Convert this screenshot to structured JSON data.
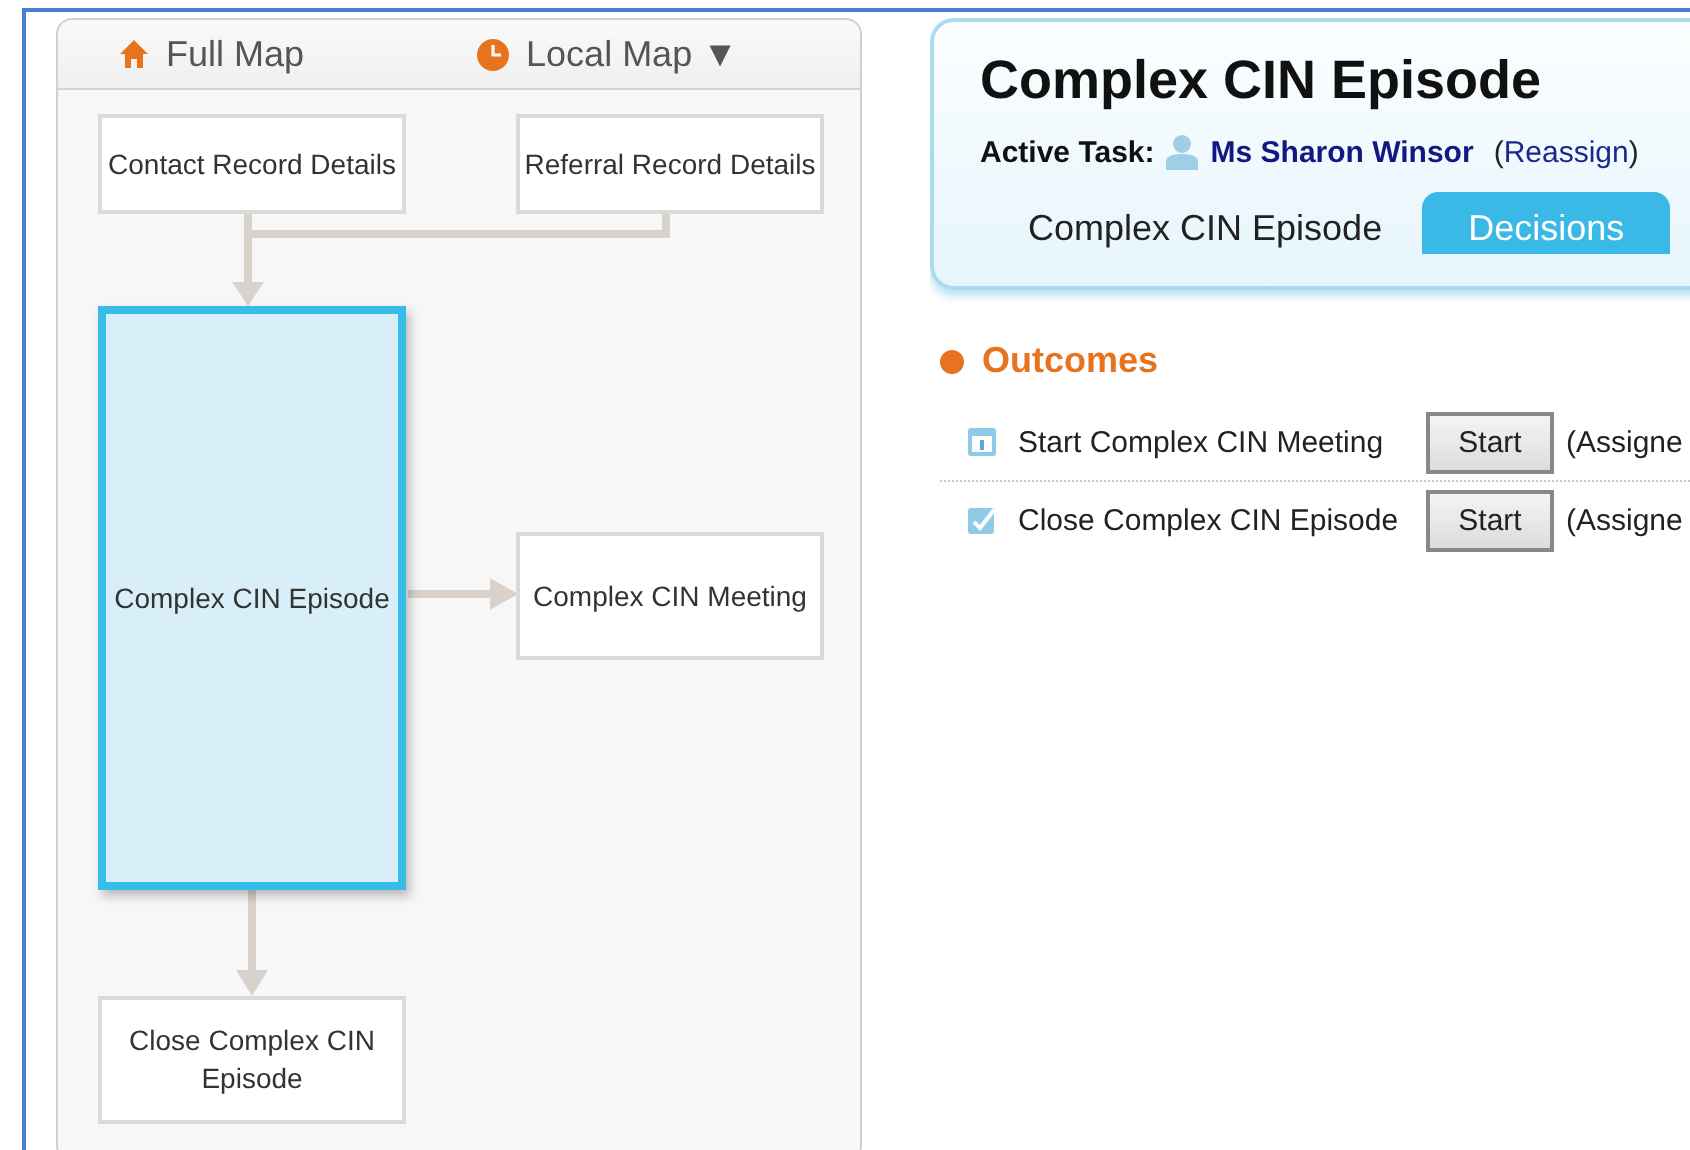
{
  "map_panel": {
    "tabs": [
      {
        "label": "Full Map"
      },
      {
        "label": "Local Map ▼"
      }
    ],
    "nodes": [
      {
        "label": "Contact Record Details",
        "selected": false
      },
      {
        "label": "Referral Record Details",
        "selected": false
      },
      {
        "label": "Complex CIN Episode",
        "selected": true
      },
      {
        "label": "Complex CIN Meeting",
        "selected": false
      },
      {
        "label": "Close Complex CIN Episode",
        "selected": false
      }
    ]
  },
  "header": {
    "title": "Complex CIN Episode",
    "active_task_label": "Active Task:",
    "assignee": "Ms Sharon Winsor",
    "reassign": "Reassign",
    "paren_open": "(",
    "paren_close": ")",
    "tabs": [
      {
        "label": "Complex CIN Episode",
        "selected": false
      },
      {
        "label": "Decisions",
        "selected": true
      }
    ]
  },
  "outcomes": {
    "title": "Outcomes",
    "rows": [
      {
        "label": "Start Complex CIN Meeting",
        "button": "Start",
        "note": "(Assigne"
      },
      {
        "label": "Close Complex CIN Episode",
        "button": "Start",
        "note": "(Assigne"
      }
    ]
  }
}
